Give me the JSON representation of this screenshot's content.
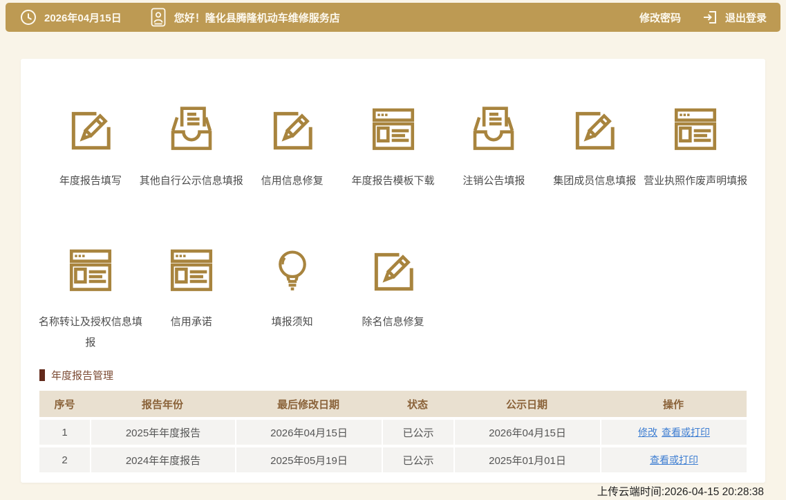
{
  "topbar": {
    "date": "2026年04月15日",
    "greeting": "您好！隆化县腾隆机动车维修服务店",
    "change_password_label": "修改密码",
    "logout_label": "退出登录"
  },
  "modules": {
    "items": [
      {
        "label": "年度报告填写",
        "icon": "edit-icon"
      },
      {
        "label": "其他自行公示信息填报",
        "icon": "inbox-icon"
      },
      {
        "label": "信用信息修复",
        "icon": "edit-icon"
      },
      {
        "label": "年度报告模板下载",
        "icon": "browser-icon"
      },
      {
        "label": "注销公告填报",
        "icon": "inbox-icon"
      },
      {
        "label": "集团成员信息填报",
        "icon": "edit-icon"
      },
      {
        "label": "营业执照作废声明填报",
        "icon": "browser-icon"
      },
      {
        "label": "名称转让及授权信息填报",
        "icon": "browser-icon"
      },
      {
        "label": "信用承诺",
        "icon": "browser-icon"
      },
      {
        "label": "填报须知",
        "icon": "bulb-icon"
      },
      {
        "label": "除名信息修复",
        "icon": "edit-icon"
      }
    ]
  },
  "report_management": {
    "section_title": "年度报告管理",
    "table": {
      "headers": [
        "序号",
        "报告年份",
        "最后修改日期",
        "状态",
        "公示日期",
        "操作"
      ],
      "rows": [
        {
          "no": "1",
          "report_year": "2025年年度报告",
          "last_modified": "2026年04月15日",
          "status": "已公示",
          "publish_date": "2026年04月15日",
          "action_modify": "修改",
          "action_view_print": "查看或打印"
        },
        {
          "no": "2",
          "report_year": "2024年年度报告",
          "last_modified": "2025年05月19日",
          "status": "已公示",
          "publish_date": "2025年01月01日",
          "action_view_print": "查看或打印"
        }
      ]
    }
  },
  "footer": {
    "upload_time_label": "上传云端时间:2026-04-15 20:28:38"
  },
  "colors": {
    "topbar_gold": "#bd9a53",
    "icon_gold": "#a8843e",
    "page_bg": "#f9f4e8",
    "table_header_bg": "#e9e0d0",
    "table_header_text": "#8a6239",
    "section_title_text": "#7b4a33",
    "section_title_bar": "#632a1c",
    "row_bg": "#f4f3f1",
    "link_blue": "#3e7ed2"
  }
}
